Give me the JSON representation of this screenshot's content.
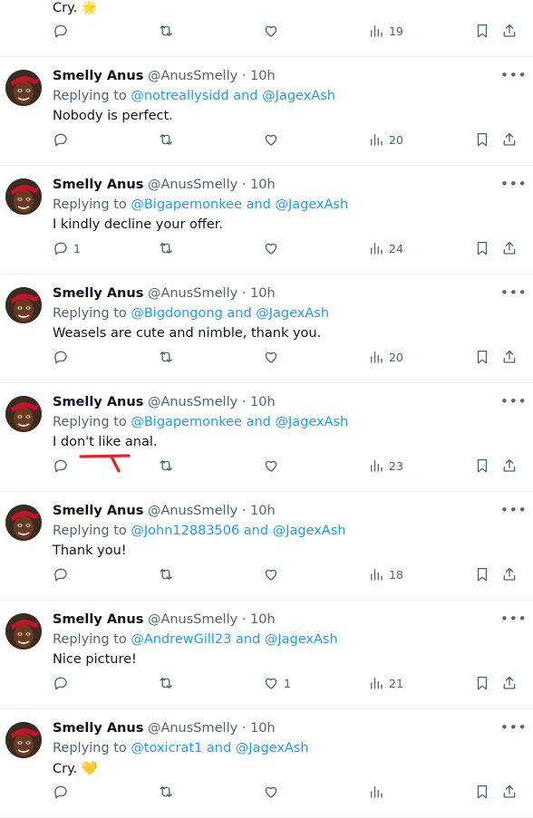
{
  "colors": {
    "text": "#0f1419",
    "secondary": "#536471",
    "link": "#1d9bf0",
    "annotation": "#e0242a"
  },
  "partial_top_tweet": {
    "text": "Cry. 🌟",
    "stats": {
      "replies": "",
      "retweets": "",
      "likes": "",
      "views": "19"
    }
  },
  "tweets": [
    {
      "name": "Smelly Anus",
      "handle": "@AnusSmelly",
      "separator": "·",
      "time": "10h",
      "replying_prefix": "Replying to",
      "mentions": "@notreallysidd and @JagexAsh",
      "text": "Nobody is perfect.",
      "stats": {
        "replies": "",
        "retweets": "",
        "likes": "",
        "views": "20"
      }
    },
    {
      "name": "Smelly Anus",
      "handle": "@AnusSmelly",
      "separator": "·",
      "time": "10h",
      "replying_prefix": "Replying to",
      "mentions": "@Bigapemonkee and @JagexAsh",
      "text": "I kindly decline your offer.",
      "stats": {
        "replies": "1",
        "retweets": "",
        "likes": "",
        "views": "24"
      }
    },
    {
      "name": "Smelly Anus",
      "handle": "@AnusSmelly",
      "separator": "·",
      "time": "10h",
      "replying_prefix": "Replying to",
      "mentions": "@Bigdongong and @JagexAsh",
      "text": "Weasels are cute and nimble, thank you.",
      "stats": {
        "replies": "",
        "retweets": "",
        "likes": "",
        "views": "20"
      }
    },
    {
      "name": "Smelly Anus",
      "handle": "@AnusSmelly",
      "separator": "·",
      "time": "10h",
      "replying_prefix": "Replying to",
      "mentions": "@Bigapemonkee and @JagexAsh",
      "text": "I don't like anal.",
      "stats": {
        "replies": "",
        "retweets": "",
        "likes": "",
        "views": "23"
      }
    },
    {
      "name": "Smelly Anus",
      "handle": "@AnusSmelly",
      "separator": "·",
      "time": "10h",
      "replying_prefix": "Replying to",
      "mentions": "@John12883506 and @JagexAsh",
      "text": "Thank you!",
      "stats": {
        "replies": "",
        "retweets": "",
        "likes": "",
        "views": "18"
      }
    },
    {
      "name": "Smelly Anus",
      "handle": "@AnusSmelly",
      "separator": "·",
      "time": "10h",
      "replying_prefix": "Replying to",
      "mentions": "@AndrewGill23 and @JagexAsh",
      "text": "Nice picture!",
      "stats": {
        "replies": "",
        "retweets": "",
        "likes": "1",
        "views": "21"
      }
    },
    {
      "name": "Smelly Anus",
      "handle": "@AnusSmelly",
      "separator": "·",
      "time": "10h",
      "replying_prefix": "Replying to",
      "mentions": "@toxicrat1 and @JagexAsh",
      "text": "Cry. 💛",
      "stats": {
        "replies": "",
        "retweets": "",
        "likes": "",
        "views": ""
      }
    }
  ]
}
